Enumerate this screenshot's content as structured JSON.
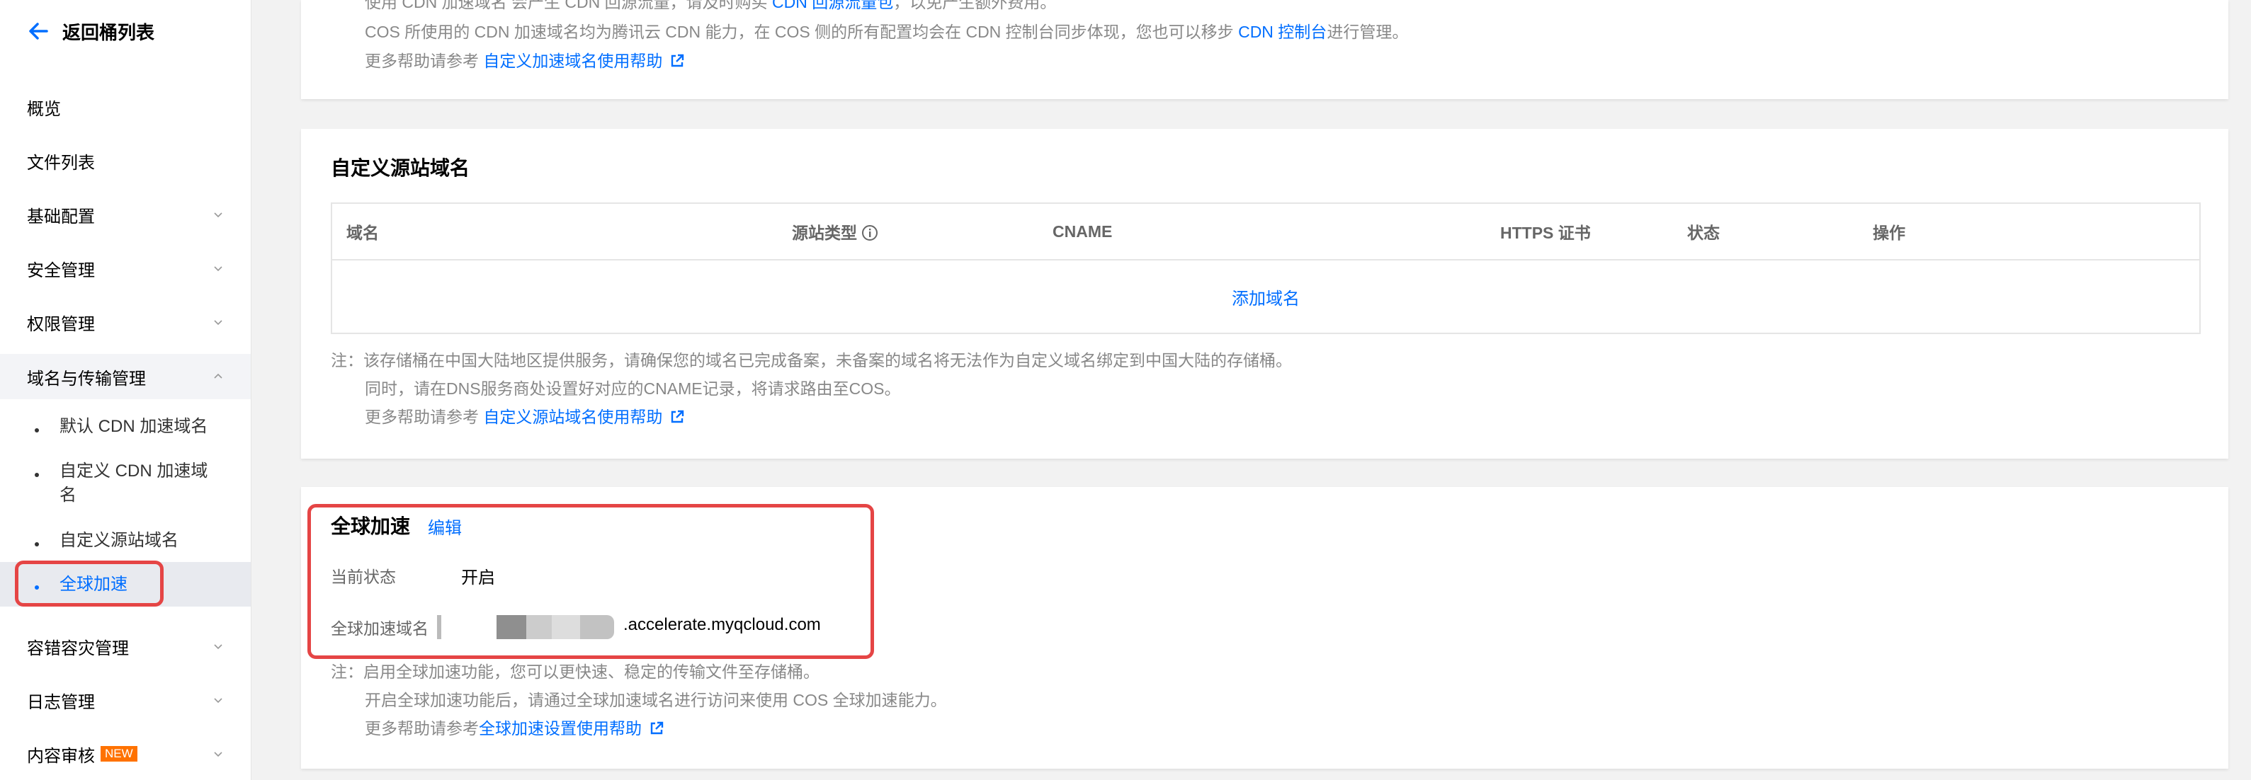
{
  "sidebar": {
    "back_label": "返回桶列表",
    "items": [
      {
        "label": "概览"
      },
      {
        "label": "文件列表"
      },
      {
        "label": "基础配置"
      },
      {
        "label": "安全管理"
      },
      {
        "label": "权限管理"
      },
      {
        "label": "域名与传输管理"
      },
      {
        "label": "容错容灾管理"
      },
      {
        "label": "日志管理"
      },
      {
        "label": "内容审核"
      }
    ],
    "sub_items": [
      {
        "label": "默认 CDN 加速域名"
      },
      {
        "label": "自定义 CDN 加速域名"
      },
      {
        "label": "自定义源站域名"
      },
      {
        "label": "全球加速"
      }
    ],
    "new_badge": "NEW"
  },
  "cdn_card": {
    "line1_a": "使用 CDN 加速域名 会产生 CDN 回源流量，请及时购买 ",
    "line1_link": "CDN 回源流量包",
    "line1_b": "，以免产生额外费用。",
    "line2_a": "COS 所使用的 CDN 加速域名均为腾讯云 CDN 能力，在 COS 侧的所有配置均会在 CDN 控制台同步体现，您也可以移步 ",
    "line2_link": "CDN 控制台",
    "line2_b": "进行管理。",
    "help_prefix": "更多帮助请参考 ",
    "help_link": "自定义加速域名使用帮助"
  },
  "origin_card": {
    "title": "自定义源站域名",
    "columns": [
      "域名",
      "源站类型",
      "CNAME",
      "HTTPS 证书",
      "状态",
      "操作"
    ],
    "add_link": "添加域名",
    "note1": "注：该存储桶在中国大陆地区提供服务，请确保您的域名已完成备案，未备案的域名将无法作为自定义域名绑定到中国大陆的存储桶。",
    "note2": "同时，请在DNS服务商处设置好对应的CNAME记录，将请求路由至COS。",
    "help_prefix": "更多帮助请参考 ",
    "help_link": "自定义源站域名使用帮助"
  },
  "global_card": {
    "title": "全球加速",
    "edit_label": "编辑",
    "status_label": "当前状态",
    "status_value": "开启",
    "domain_label": "全球加速域名",
    "domain_suffix": ".accelerate.myqcloud.com",
    "note1": "注：启用全球加速功能，您可以更快速、稳定的传输文件至存储桶。",
    "note2": "开启全球加速功能后，请通过全球加速域名进行访问来使用 COS 全球加速能力。",
    "help_prefix": "更多帮助请参考",
    "help_link": "全球加速设置使用帮助"
  },
  "colors": {
    "link": "#006eff",
    "highlight_box": "#e54545",
    "new_badge": "#ff7200"
  }
}
